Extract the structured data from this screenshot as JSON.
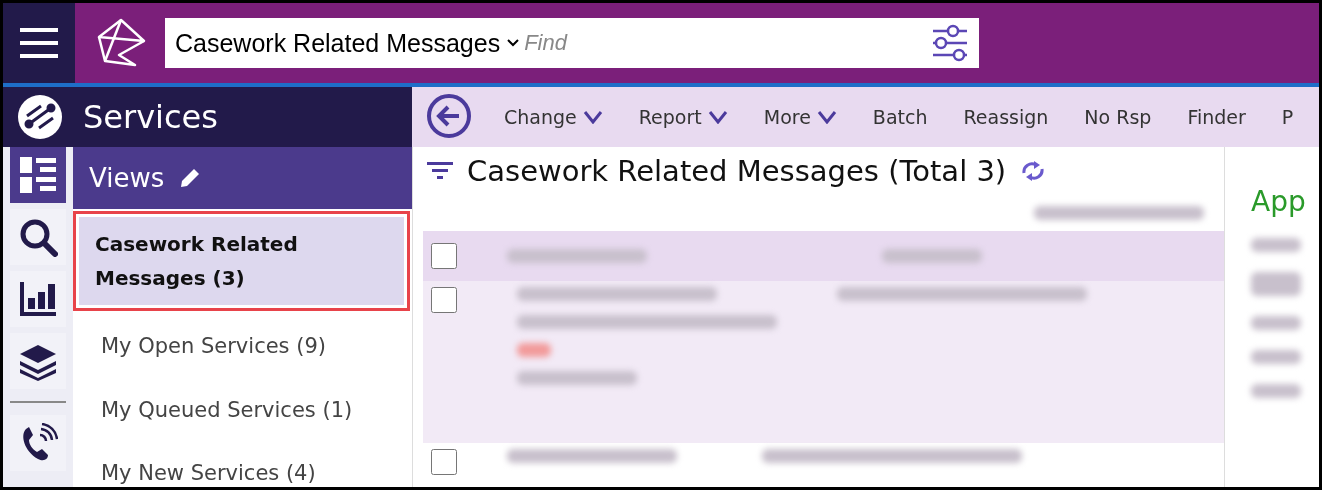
{
  "search": {
    "scope": "Casework Related Messages",
    "placeholder": "Find"
  },
  "sidebar": {
    "title": "Services",
    "section": "Views",
    "items": [
      {
        "label": "Casework Related Messages (3)",
        "selected": true
      },
      {
        "label": "My Open Services (9)",
        "selected": false
      },
      {
        "label": "My Queued Services (1)",
        "selected": false
      },
      {
        "label": "My New Services (4)",
        "selected": false
      }
    ]
  },
  "rail": [
    {
      "kind": "views",
      "selected": true
    },
    {
      "kind": "search",
      "selected": false
    },
    {
      "kind": "reports",
      "selected": false
    },
    {
      "kind": "layers",
      "selected": false
    },
    {
      "kind": "phone",
      "selected": false
    }
  ],
  "toolbar": [
    {
      "label": "Change",
      "dropdown": true
    },
    {
      "label": "Report",
      "dropdown": true
    },
    {
      "label": "More",
      "dropdown": true
    },
    {
      "label": "Batch",
      "dropdown": false
    },
    {
      "label": "Reassign",
      "dropdown": false
    },
    {
      "label": "No Rsp",
      "dropdown": false
    },
    {
      "label": "Finder",
      "dropdown": false
    },
    {
      "label": "P",
      "dropdown": false
    }
  ],
  "list": {
    "title": "Casework Related Messages (Total 3)",
    "rows": [
      {
        "checked": false
      },
      {
        "checked": false
      },
      {
        "checked": false
      }
    ]
  },
  "right_panel": {
    "heading": "App"
  }
}
